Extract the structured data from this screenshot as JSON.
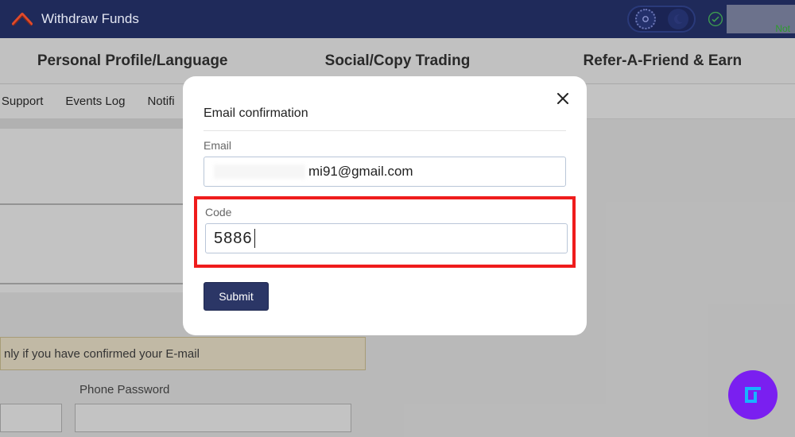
{
  "header": {
    "title": "Withdraw Funds",
    "notif_fragment": "Not"
  },
  "tabs": {
    "personal": "Personal Profile/Language",
    "social": "Social/Copy Trading",
    "refer": "Refer-A-Friend & Earn"
  },
  "subtabs": {
    "support": "al Support",
    "events": "Events Log",
    "notifications": "Notifi"
  },
  "notice": {
    "text": "nly if you have confirmed your E-mail"
  },
  "phone": {
    "label": "Phone Password"
  },
  "modal": {
    "title": "Email confirmation",
    "email_label": "Email",
    "email_suffix": "mi91@gmail.com",
    "code_label": "Code",
    "code_value": "5886",
    "submit": "Submit"
  }
}
